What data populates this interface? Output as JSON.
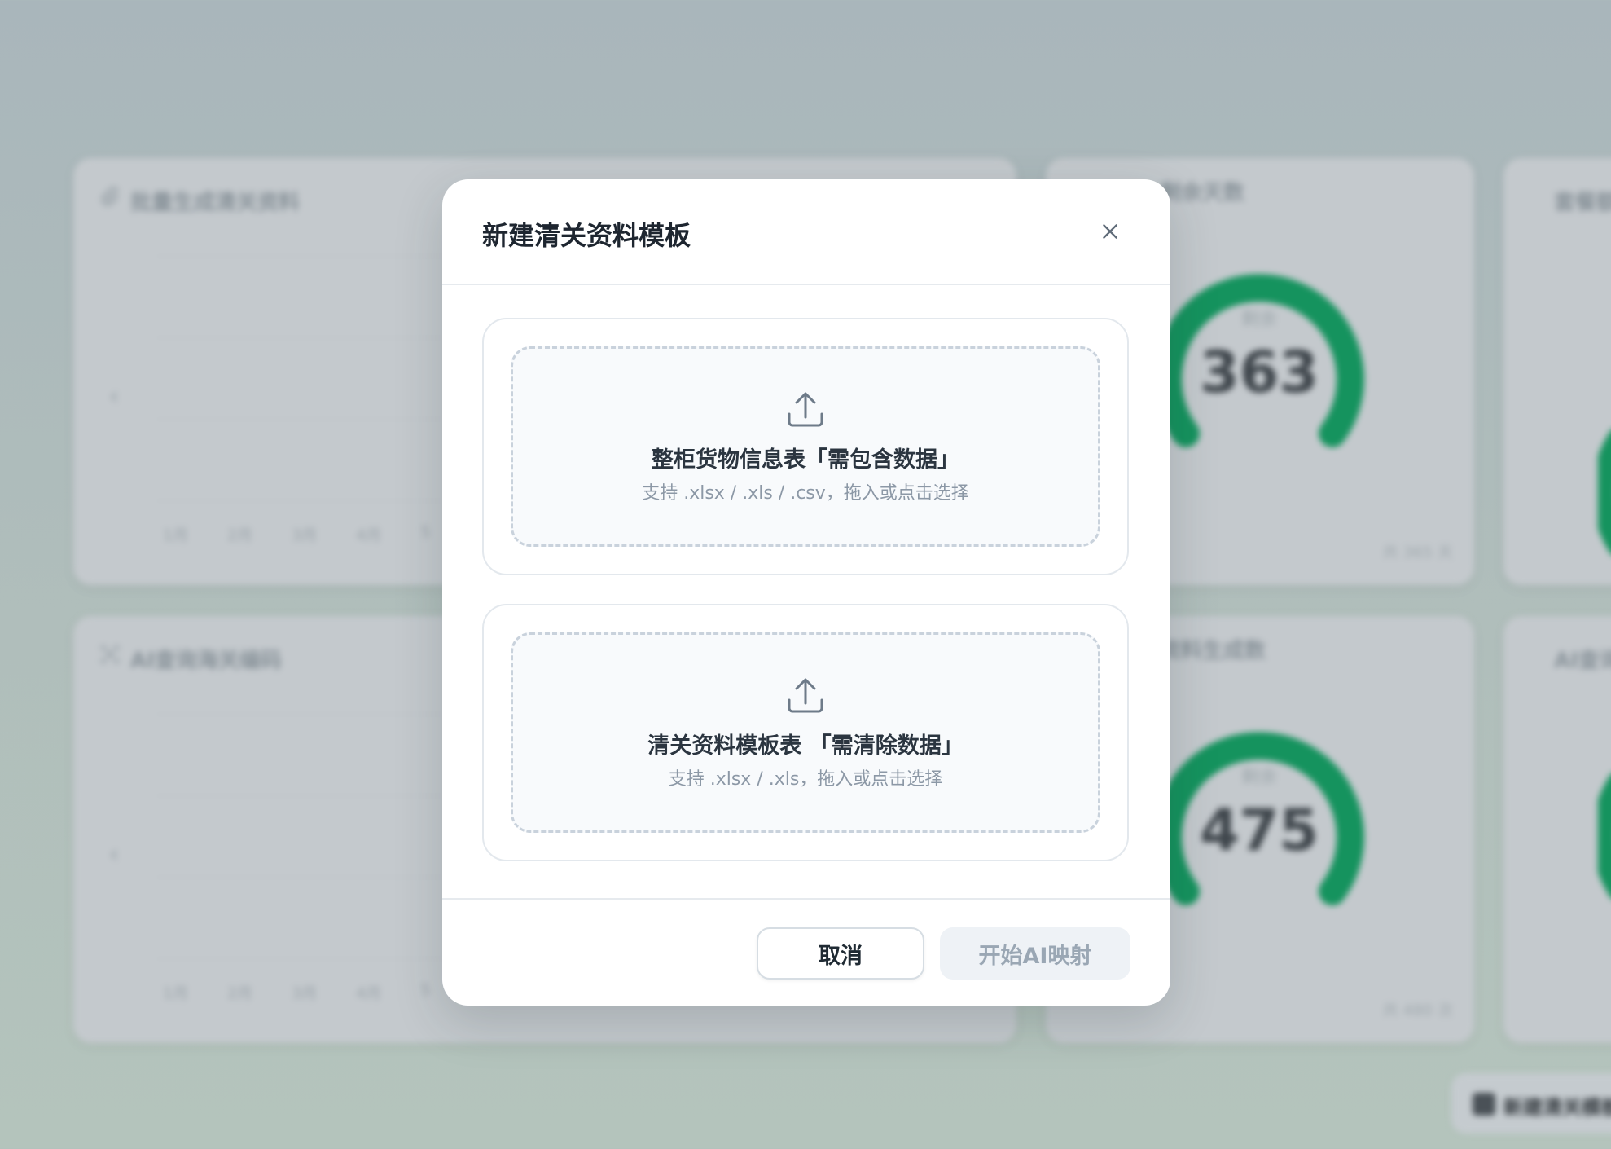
{
  "background": {
    "cards": [
      {
        "title": "批量生成清关资料",
        "months": [
          "1月",
          "2月",
          "3月",
          "4月",
          "5"
        ]
      },
      {
        "title": "AI查询海关编码",
        "months": [
          "1月",
          "2月",
          "3月",
          "4月",
          "5"
        ]
      }
    ],
    "gauges": [
      {
        "title": "剩余天数",
        "label": "剩余",
        "value": "363",
        "foot": "共 365 天"
      },
      {
        "title": "资料生成数",
        "label": "剩余",
        "value": "475",
        "foot": "共 480 次"
      }
    ],
    "right_cards": [
      "套餐额度",
      "AI查询"
    ],
    "fab_label": "新建清关模板"
  },
  "modal": {
    "title": "新建清关资料模板",
    "uploads": [
      {
        "title": "整柜货物信息表「需包含数据」",
        "hint": "支持 .xlsx / .xls / .csv，拖入或点击选择"
      },
      {
        "title": "清关资料模板表 「需清除数据」",
        "hint": "支持 .xlsx / .xls，拖入或点击选择"
      }
    ],
    "cancel_label": "取消",
    "start_label": "开始AI映射"
  },
  "colors": {
    "gauge_green": "#15935e",
    "disabled_text": "#9aa7b4"
  }
}
